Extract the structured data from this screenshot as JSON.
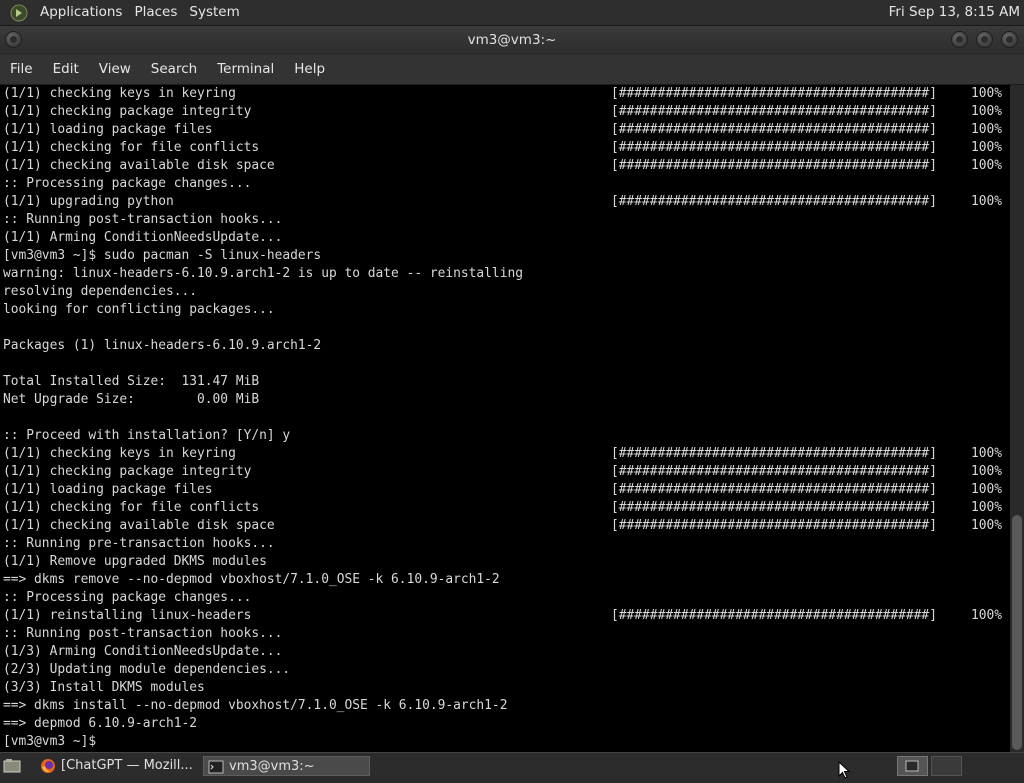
{
  "top_panel": {
    "menus": [
      "Applications",
      "Places",
      "System"
    ],
    "clock": "Fri Sep 13,  8:15 AM"
  },
  "window": {
    "title": "vm3@vm3:~"
  },
  "menubar": [
    "File",
    "Edit",
    "View",
    "Search",
    "Terminal",
    "Help"
  ],
  "terminal": {
    "lines": [
      {
        "text": "(1/1) checking keys in keyring",
        "bar": "[########################################]",
        "pct": "100%"
      },
      {
        "text": "(1/1) checking package integrity",
        "bar": "[########################################]",
        "pct": "100%"
      },
      {
        "text": "(1/1) loading package files",
        "bar": "[########################################]",
        "pct": "100%"
      },
      {
        "text": "(1/1) checking for file conflicts",
        "bar": "[########################################]",
        "pct": "100%"
      },
      {
        "text": "(1/1) checking available disk space",
        "bar": "[########################################]",
        "pct": "100%"
      },
      {
        "text": ":: Processing package changes..."
      },
      {
        "text": "(1/1) upgrading python",
        "bar": "[########################################]",
        "pct": "100%"
      },
      {
        "text": ":: Running post-transaction hooks..."
      },
      {
        "text": "(1/1) Arming ConditionNeedsUpdate..."
      },
      {
        "text": "[vm3@vm3 ~]$ sudo pacman -S linux-headers"
      },
      {
        "text": "warning: linux-headers-6.10.9.arch1-2 is up to date -- reinstalling"
      },
      {
        "text": "resolving dependencies..."
      },
      {
        "text": "looking for conflicting packages..."
      },
      {
        "text": ""
      },
      {
        "text": "Packages (1) linux-headers-6.10.9.arch1-2"
      },
      {
        "text": ""
      },
      {
        "text": "Total Installed Size:  131.47 MiB"
      },
      {
        "text": "Net Upgrade Size:        0.00 MiB"
      },
      {
        "text": ""
      },
      {
        "text": ":: Proceed with installation? [Y/n] y"
      },
      {
        "text": "(1/1) checking keys in keyring",
        "bar": "[########################################]",
        "pct": "100%"
      },
      {
        "text": "(1/1) checking package integrity",
        "bar": "[########################################]",
        "pct": "100%"
      },
      {
        "text": "(1/1) loading package files",
        "bar": "[########################################]",
        "pct": "100%"
      },
      {
        "text": "(1/1) checking for file conflicts",
        "bar": "[########################################]",
        "pct": "100%"
      },
      {
        "text": "(1/1) checking available disk space",
        "bar": "[########################################]",
        "pct": "100%"
      },
      {
        "text": ":: Running pre-transaction hooks..."
      },
      {
        "text": "(1/1) Remove upgraded DKMS modules"
      },
      {
        "text": "==> dkms remove --no-depmod vboxhost/7.1.0_OSE -k 6.10.9-arch1-2"
      },
      {
        "text": ":: Processing package changes..."
      },
      {
        "text": "(1/1) reinstalling linux-headers",
        "bar": "[########################################]",
        "pct": "100%"
      },
      {
        "text": ":: Running post-transaction hooks..."
      },
      {
        "text": "(1/3) Arming ConditionNeedsUpdate..."
      },
      {
        "text": "(2/3) Updating module dependencies..."
      },
      {
        "text": "(3/3) Install DKMS modules"
      },
      {
        "text": "==> dkms install --no-depmod vboxhost/7.1.0_OSE -k 6.10.9-arch1-2"
      },
      {
        "text": "==> depmod 6.10.9-arch1-2"
      },
      {
        "text": "[vm3@vm3 ~]$ "
      }
    ]
  },
  "taskbar": {
    "tasks": [
      {
        "label": "[ChatGPT — Mozill...",
        "icon": "firefox-icon"
      },
      {
        "label": "vm3@vm3:~",
        "icon": "terminal-icon"
      }
    ]
  }
}
